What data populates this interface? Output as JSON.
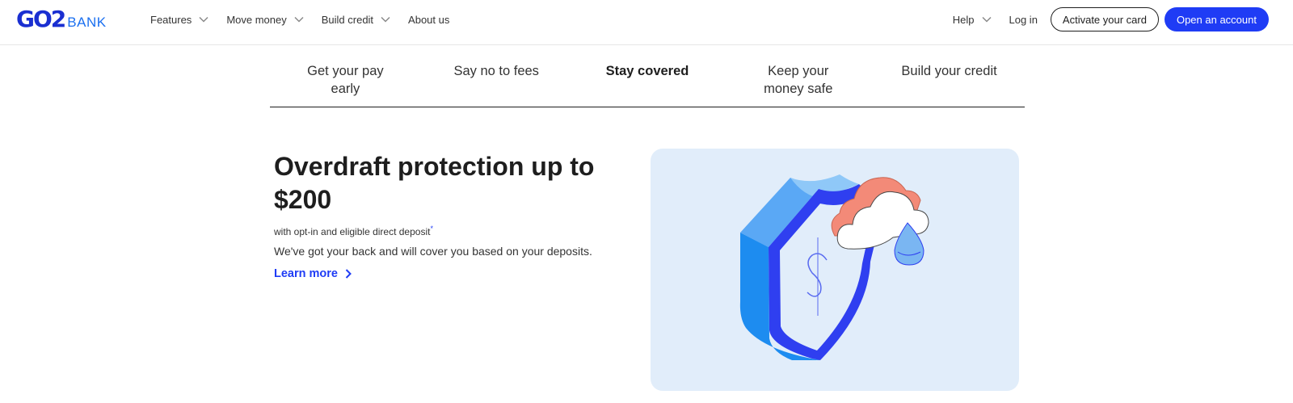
{
  "header": {
    "logo": {
      "main": "GO2",
      "sub": "BANK"
    },
    "nav": [
      {
        "label": "Features",
        "has_dropdown": true
      },
      {
        "label": "Move money",
        "has_dropdown": true
      },
      {
        "label": "Build credit",
        "has_dropdown": true
      },
      {
        "label": "About us",
        "has_dropdown": false
      }
    ],
    "help_label": "Help",
    "login_label": "Log in",
    "activate_label": "Activate your card",
    "open_account_label": "Open an account"
  },
  "tabs": [
    {
      "label": "Get your pay early",
      "active": false
    },
    {
      "label": "Say no to fees",
      "active": false
    },
    {
      "label": "Stay covered",
      "active": true
    },
    {
      "label": "Keep your money safe",
      "active": false
    },
    {
      "label": "Build your credit",
      "active": false
    }
  ],
  "main": {
    "heading": "Overdraft protection up to $200",
    "subtext": "with opt-in and eligible direct deposit",
    "subtext_mark": "*",
    "description": "We've got your back and will cover you based on your deposits.",
    "learn_more_label": "Learn more"
  },
  "colors": {
    "brand_blue": "#1f3cf5",
    "card_bg": "#e1edfa",
    "coral": "#f38a78"
  },
  "icons": {
    "illustration": "shield-cloud-icon",
    "chevron": "chevron-down-icon",
    "arrow": "chevron-right-icon"
  }
}
